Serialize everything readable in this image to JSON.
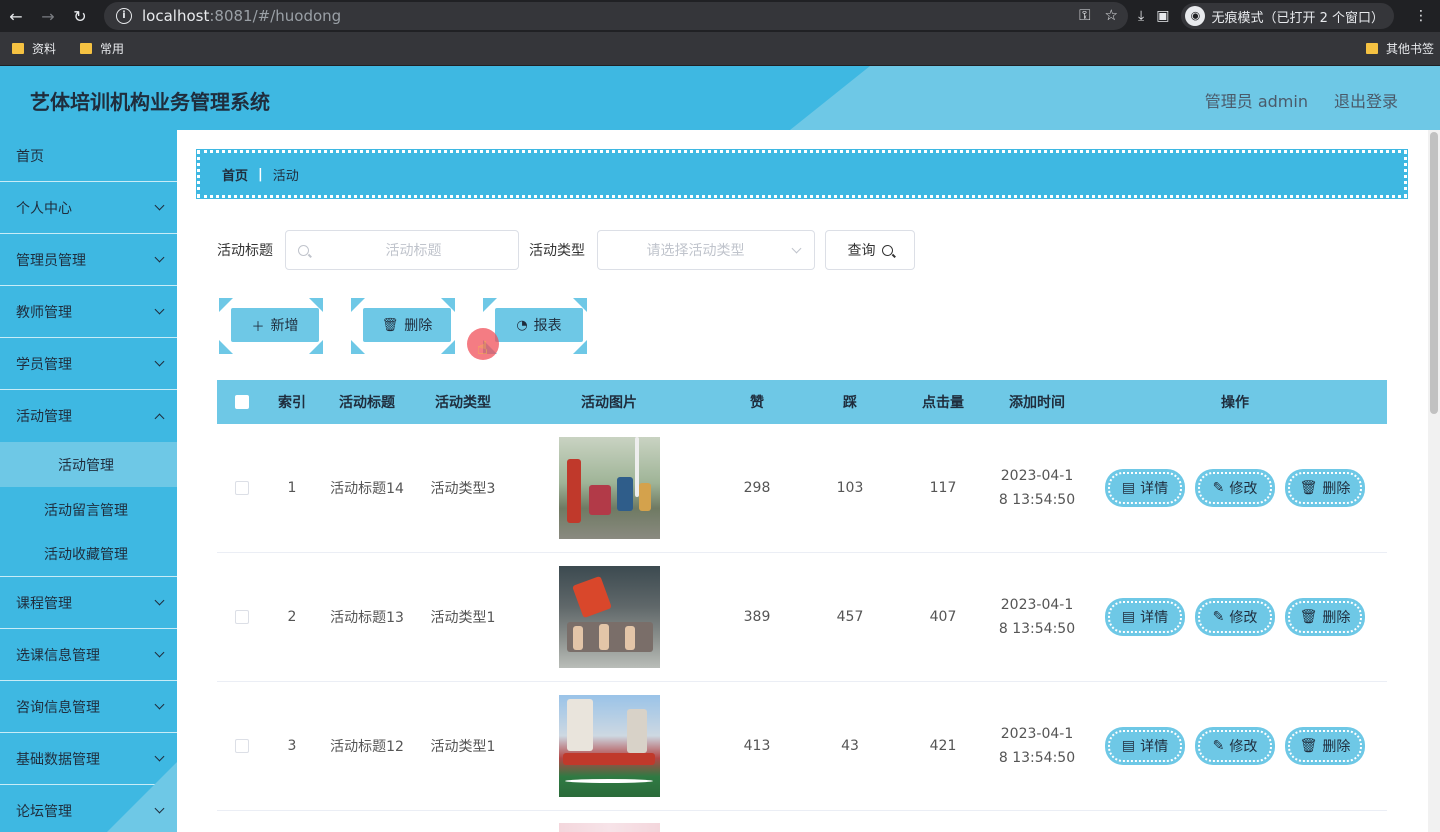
{
  "browser": {
    "url_host": "localhost",
    "url_rest": ":8081/#/huodong",
    "incognito_label": "无痕模式（已打开 2 个窗口）",
    "bookmarks": [
      "资料",
      "常用"
    ],
    "other_bookmarks": "其他书签"
  },
  "header": {
    "title": "艺体培训机构业务管理系统",
    "user": "管理员 admin",
    "logout": "退出登录"
  },
  "sidebar": {
    "items": [
      {
        "label": "首页",
        "expandable": false
      },
      {
        "label": "个人中心",
        "expandable": true
      },
      {
        "label": "管理员管理",
        "expandable": true
      },
      {
        "label": "教师管理",
        "expandable": true
      },
      {
        "label": "学员管理",
        "expandable": true
      },
      {
        "label": "活动管理",
        "expandable": true,
        "open": true
      },
      {
        "label": "课程管理",
        "expandable": true
      },
      {
        "label": "选课信息管理",
        "expandable": true
      },
      {
        "label": "咨询信息管理",
        "expandable": true
      },
      {
        "label": "基础数据管理",
        "expandable": true
      },
      {
        "label": "论坛管理",
        "expandable": true
      }
    ],
    "sub_items": [
      "活动管理",
      "活动留言管理",
      "活动收藏管理"
    ]
  },
  "breadcrumb": {
    "home": "首页",
    "current": "活动"
  },
  "filter": {
    "title_label": "活动标题",
    "title_placeholder": "活动标题",
    "type_label": "活动类型",
    "type_placeholder": "请选择活动类型",
    "query_label": "查询"
  },
  "actions": {
    "add": "新增",
    "delete": "删除",
    "report": "报表"
  },
  "table": {
    "headers": [
      "索引",
      "活动标题",
      "活动类型",
      "活动图片",
      "赞",
      "踩",
      "点击量",
      "添加时间",
      "操作"
    ],
    "rows": [
      {
        "index": "1",
        "title": "活动标题14",
        "type": "活动类型3",
        "zan": "298",
        "cai": "103",
        "hits": "117",
        "time_line1": "2023-04-1",
        "time_line2": "8 13:54:50"
      },
      {
        "index": "2",
        "title": "活动标题13",
        "type": "活动类型1",
        "zan": "389",
        "cai": "457",
        "hits": "407",
        "time_line1": "2023-04-1",
        "time_line2": "8 13:54:50"
      },
      {
        "index": "3",
        "title": "活动标题12",
        "type": "活动类型1",
        "zan": "413",
        "cai": "43",
        "hits": "421",
        "time_line1": "2023-04-1",
        "time_line2": "8 13:54:50"
      }
    ],
    "op_labels": {
      "detail": "详情",
      "edit": "修改",
      "delete": "删除"
    }
  }
}
